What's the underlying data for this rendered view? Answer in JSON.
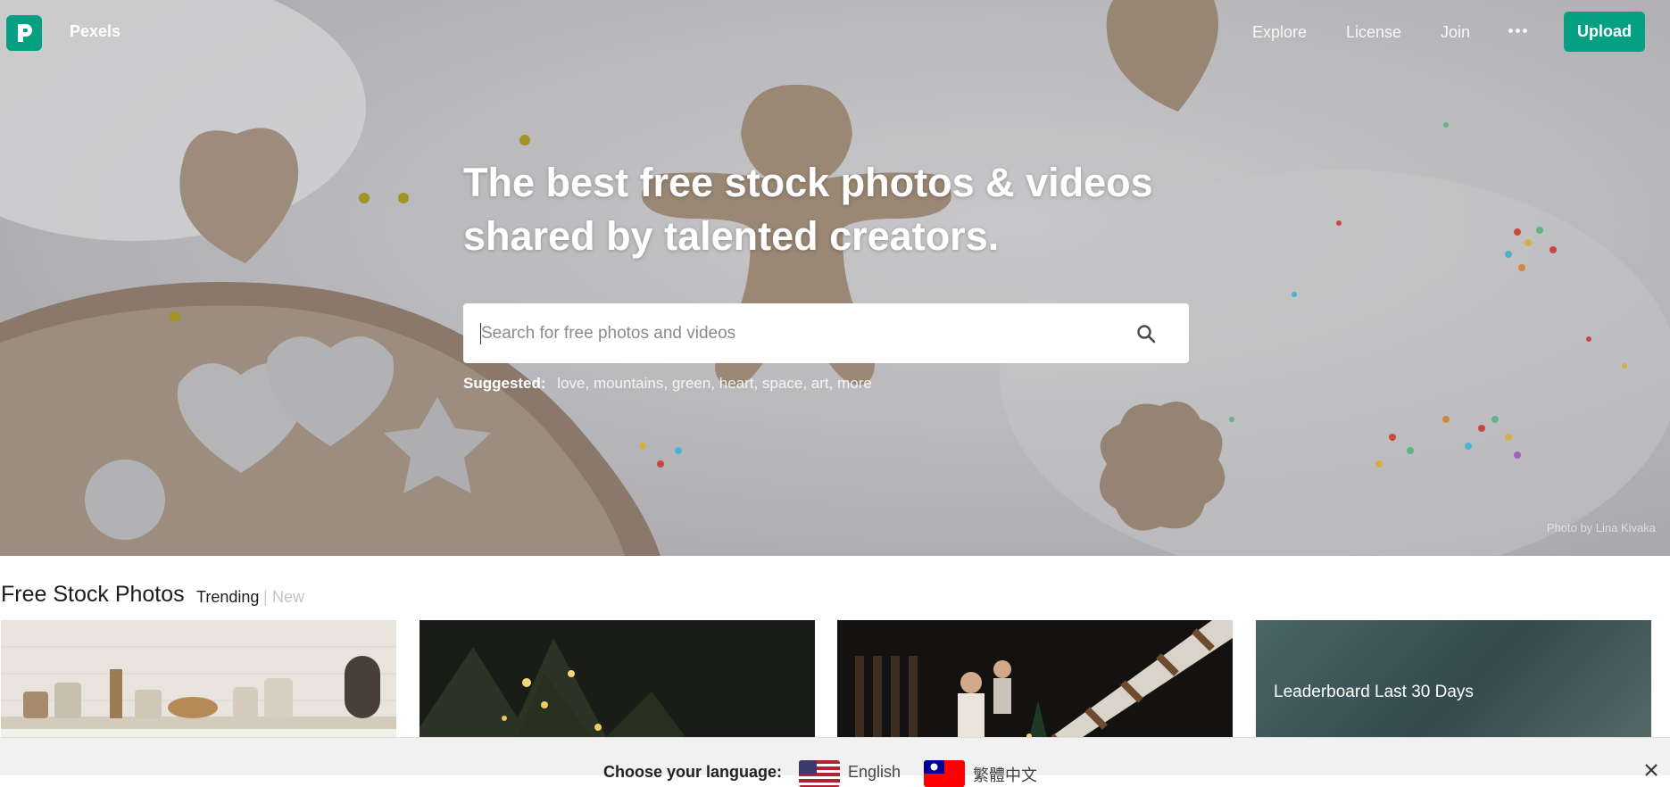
{
  "nav": {
    "brand": "Pexels",
    "links": [
      "Explore",
      "License",
      "Join"
    ],
    "upload_label": "Upload",
    "accent_color": "#05a081"
  },
  "hero": {
    "headline_line1": "The best free stock photos & videos",
    "headline_line2": "shared by talented creators.",
    "search_placeholder": "Search for free photos and videos",
    "suggested_label": "Suggested:",
    "suggested_tags": [
      "love",
      "mountains",
      "green",
      "heart",
      "space",
      "art",
      "more"
    ],
    "photo_credit": "Photo by Lina Kivaka"
  },
  "section": {
    "title": "Free Stock Photos",
    "tab_trending": "Trending",
    "tab_separator": "|",
    "tab_new": "New",
    "leaderboard_title": "Leaderboard Last 30 Days"
  },
  "language_bar": {
    "prompt": "Choose your language:",
    "options": [
      "English",
      "繁體中文"
    ]
  },
  "icons": {
    "logo": "pexels-logo-icon",
    "more": "ellipsis-icon",
    "search": "search-icon",
    "close": "close-icon"
  }
}
